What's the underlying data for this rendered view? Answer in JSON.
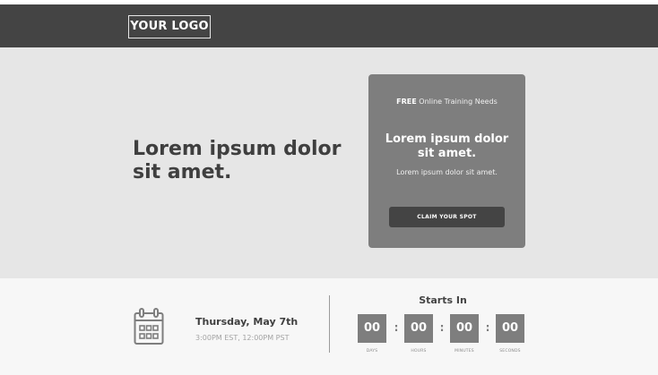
{
  "header": {
    "logo_text": "YOUR LOGO"
  },
  "hero": {
    "title": "Lorem ipsum dolor sit amet.",
    "card": {
      "free_label": "FREE",
      "free_suffix": " Online Training Needs",
      "heading": "Lorem ipsum dolor sit amet.",
      "subtext": "Lorem ipsum dolor sit amet.",
      "cta_label": "CLAIM YOUR SPOT"
    }
  },
  "event": {
    "date": "Thursday, May 7th",
    "time": "3:00PM EST, 12:00PM PST",
    "calendar_icon": "calendar-icon"
  },
  "countdown": {
    "label": "Starts In",
    "separator": ":",
    "units": [
      {
        "value": "00",
        "label": "DAYS"
      },
      {
        "value": "00",
        "label": "HOURS"
      },
      {
        "value": "00",
        "label": "MINUTES"
      },
      {
        "value": "00",
        "label": "SECONDS"
      }
    ]
  },
  "colors": {
    "header_bg": "#444444",
    "hero_bg": "#e6e6e6",
    "card_bg": "#7e7e7e",
    "button_bg": "#444444",
    "footer_bg": "#f7f7f7"
  }
}
